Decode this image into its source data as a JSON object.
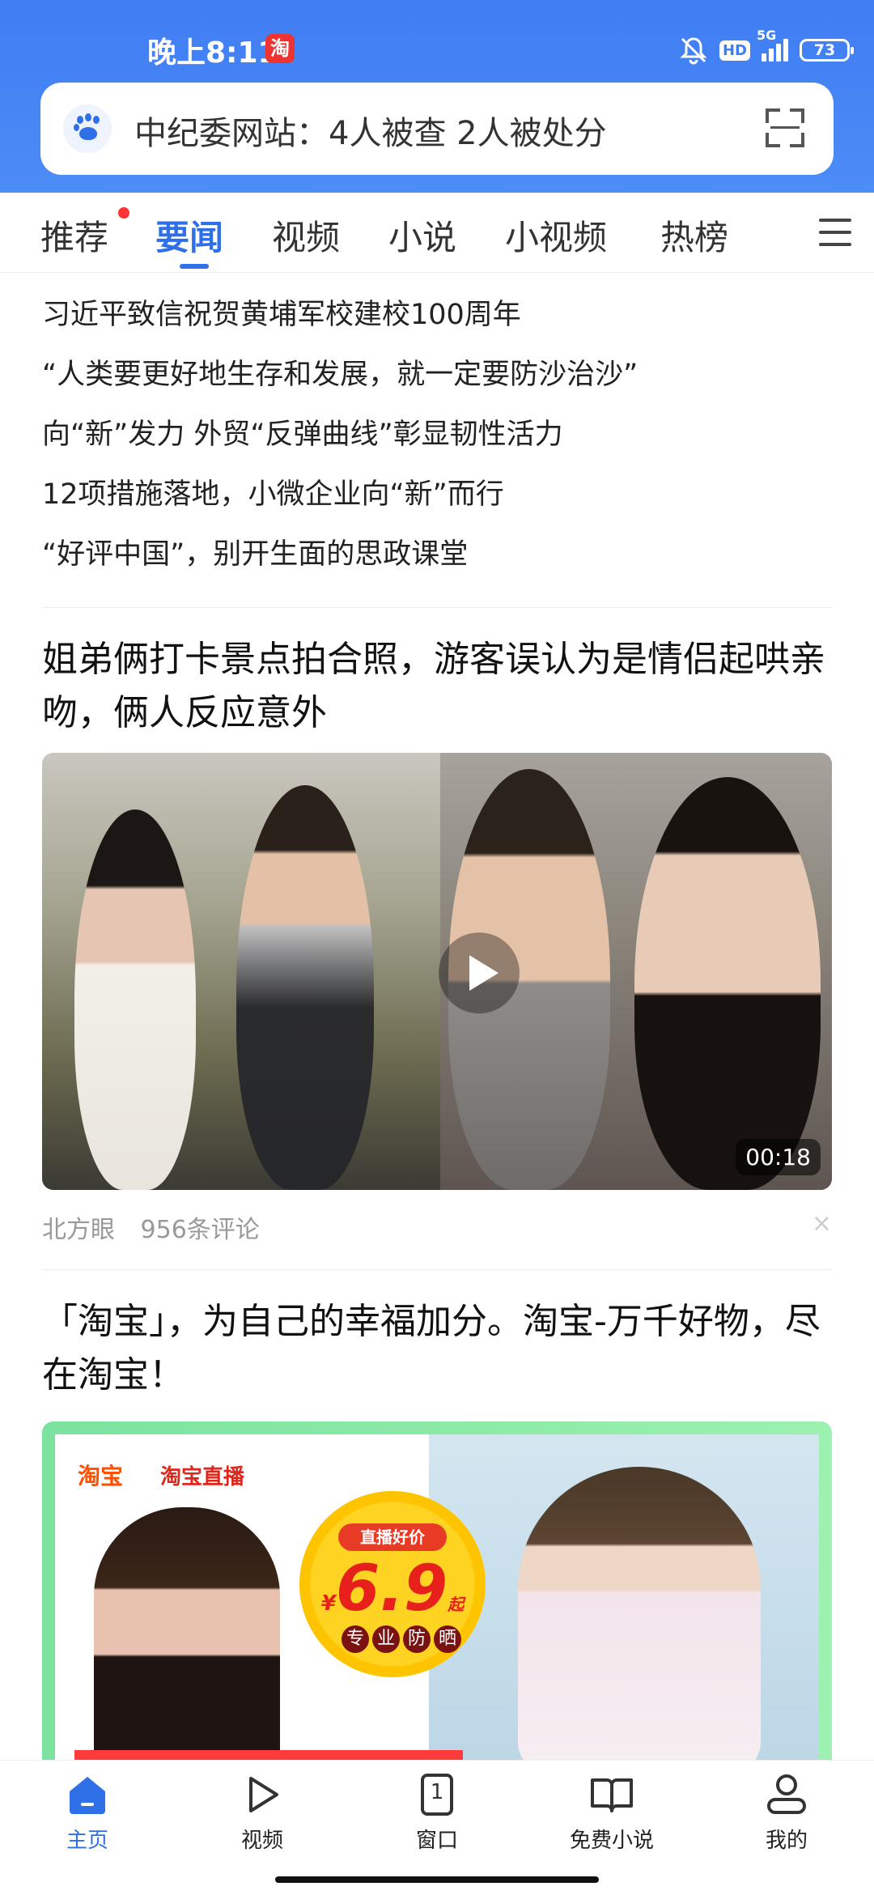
{
  "status_bar": {
    "time": "晚上8:11",
    "app_badge": "淘",
    "network": "5G",
    "hd": "HD",
    "battery": "73"
  },
  "search": {
    "query": "中纪委网站：4人被查 2人被处分"
  },
  "tabs": [
    {
      "label": "推荐"
    },
    {
      "label": "要闻"
    },
    {
      "label": "视频"
    },
    {
      "label": "小说"
    },
    {
      "label": "小视频"
    },
    {
      "label": "热榜"
    }
  ],
  "headlines": [
    "习近平致信祝贺黄埔军校建校100周年",
    "“人类要更好地生存和发展，就一定要防沙治沙”",
    "向“新”发力 外贸“反弹曲线”彰显韧性活力",
    "12项措施落地，小微企业向“新”而行",
    "“好评中国”，别开生面的思政课堂"
  ],
  "video_article": {
    "title": "姐弟俩打卡景点拍合照，游客误认为是情侣起哄亲吻，俩人反应意外",
    "duration": "00:18",
    "source": "北方眼",
    "comments": "956条评论"
  },
  "ad_article": {
    "title": "「淘宝」，为自己的幸福加分。淘宝-万千好物，尽在淘宝！",
    "brand": "淘宝",
    "live": "淘宝直播",
    "badge_top": "直播好价",
    "price_currency": "¥",
    "price": "6.9",
    "price_suffix": "起",
    "tags": [
      "专",
      "业",
      "防",
      "晒"
    ]
  },
  "bottom_nav": [
    {
      "label": "主页"
    },
    {
      "label": "视频"
    },
    {
      "label": "窗口",
      "count": "1"
    },
    {
      "label": "免费小说"
    },
    {
      "label": "我的"
    }
  ],
  "colors": {
    "accent": "#2f6fe8",
    "header": "#4c8cf6",
    "notification_dot": "#ff3333",
    "taobao_orange": "#ff5000"
  }
}
